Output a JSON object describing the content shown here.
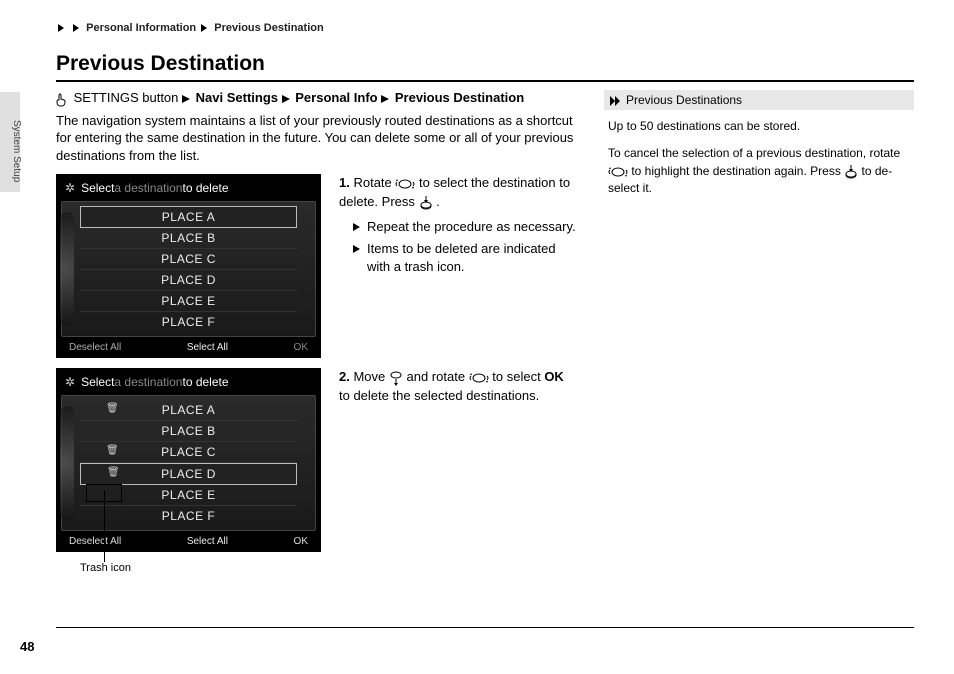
{
  "breadcrumb": {
    "seg1": "Personal Information",
    "seg2": "Previous Destination"
  },
  "side_tab": "System Setup",
  "title": "Previous Destination",
  "nav_path": {
    "prefix": "SETTINGS button",
    "s1": "Navi Settings",
    "s2": "Personal Info",
    "s3": "Previous Destination"
  },
  "intro": "The navigation system maintains a list of your previously routed destinations as a shortcut for entering the same destination in the future. You can delete some or all of your previous destinations from the list.",
  "screen1": {
    "header_pre": "Select",
    "header_mid": " a destination ",
    "header_post": "to delete",
    "items": [
      "PLACE A",
      "PLACE B",
      "PLACE C",
      "PLACE D",
      "PLACE E",
      "PLACE F"
    ],
    "footer_left": "Deselect All",
    "footer_mid": "Select All",
    "footer_right": "OK"
  },
  "screen2": {
    "header_pre": "Select",
    "header_mid": " a destination ",
    "header_post": "to delete",
    "items": [
      "PLACE A",
      "PLACE B",
      "PLACE C",
      "PLACE D",
      "PLACE E",
      "PLACE F"
    ],
    "trash_rows": [
      0,
      2,
      3
    ],
    "footer_left": "Deselect All",
    "footer_mid": "Select All",
    "footer_right": "OK"
  },
  "trash_callout": "Trash icon",
  "steps": {
    "s1_num": "1.",
    "s1a": "Rotate ",
    "s1b": " to select the destination to delete. Press ",
    "s1c": ".",
    "s1_sub1": "Repeat the procedure as necessary.",
    "s1_sub2": "Items to be deleted are indicated with a trash icon.",
    "s2_num": "2.",
    "s2a": "Move ",
    "s2b": " and rotate ",
    "s2c": " to select ",
    "s2_ok": "OK",
    "s2d": " to delete the selected destinations."
  },
  "sidebar": {
    "header": "Previous Destinations",
    "p1": "Up to 50 destinations can be stored.",
    "p2a": "To cancel the selection of a previous destination, rotate ",
    "p2b": " to highlight the destination again. Press ",
    "p2c": " to de-select it."
  },
  "page_number": "48"
}
